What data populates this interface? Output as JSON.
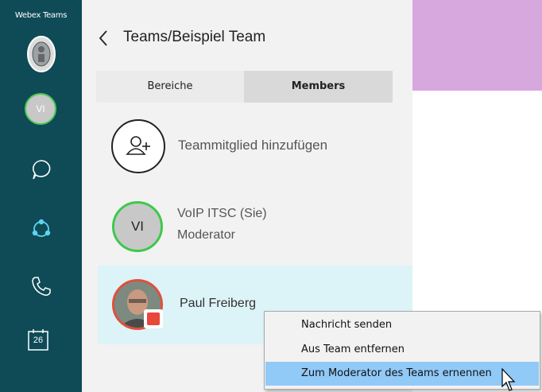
{
  "app": {
    "title": "Webex Teams"
  },
  "sidebar": {
    "user_initials": "VI",
    "calendar_date": "26"
  },
  "header": {
    "title": "Teams/Beispiel Team"
  },
  "tabs": [
    {
      "label": "Bereiche",
      "active": false
    },
    {
      "label": "Members",
      "active": true
    }
  ],
  "add_member": {
    "label": "Teammitglied hinzufügen"
  },
  "members": [
    {
      "initials": "VI",
      "name": "VoIP ITSC (Sie)",
      "role": "Moderator",
      "status_color": "#3ec84e"
    },
    {
      "name": "Paul Freiberg",
      "status_color": "#e0503a"
    }
  ],
  "context_menu": {
    "items": [
      {
        "label": "Nachricht senden"
      },
      {
        "label": "Aus Team entfernen"
      },
      {
        "label": "Zum Moderator des Teams ernennen",
        "highlighted": true
      }
    ]
  },
  "colors": {
    "sidebar": "#0e4b57",
    "accent_block": "#d7a8de",
    "selected_row": "#dcf3f8",
    "menu_highlight": "#91c9f7"
  }
}
